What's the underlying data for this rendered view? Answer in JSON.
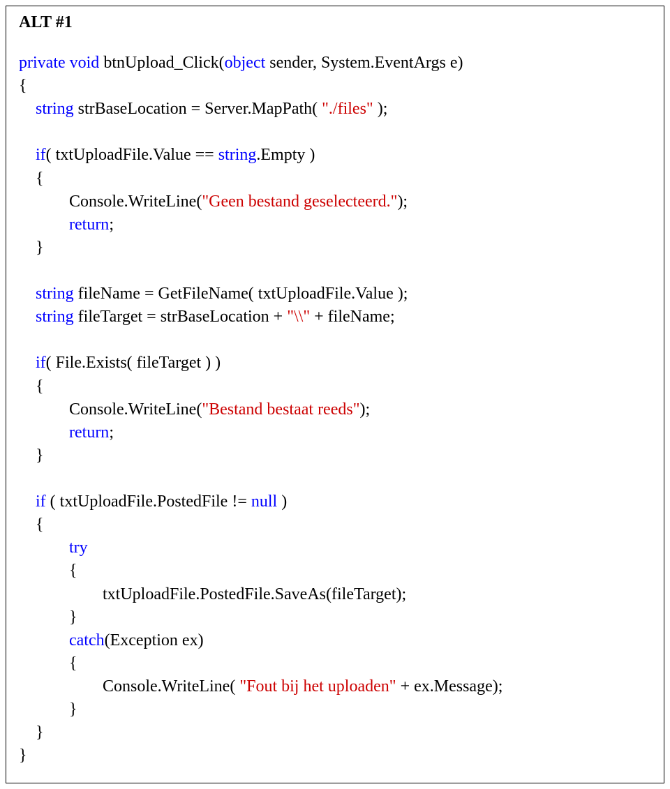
{
  "heading": "ALT #1",
  "code_segments": [
    {
      "t": "private void",
      "c": "kw"
    },
    {
      "t": " btnUpload_Click(",
      "c": ""
    },
    {
      "t": "object",
      "c": "kw"
    },
    {
      "t": " sender, System.EventArgs e)\n{\n    ",
      "c": ""
    },
    {
      "t": "string",
      "c": "kw"
    },
    {
      "t": " strBaseLocation = Server.MapPath( ",
      "c": ""
    },
    {
      "t": "\"./files\"",
      "c": "str"
    },
    {
      "t": " );\n\n    ",
      "c": ""
    },
    {
      "t": "if",
      "c": "kw"
    },
    {
      "t": "( txtUploadFile.Value == ",
      "c": ""
    },
    {
      "t": "string",
      "c": "kw"
    },
    {
      "t": ".Empty )\n    {\n            Console.WriteLine(",
      "c": ""
    },
    {
      "t": "\"Geen bestand geselecteerd.\"",
      "c": "str"
    },
    {
      "t": ");\n            ",
      "c": ""
    },
    {
      "t": "return",
      "c": "kw"
    },
    {
      "t": ";\n    }\n\n    ",
      "c": ""
    },
    {
      "t": "string",
      "c": "kw"
    },
    {
      "t": " fileName = GetFileName( txtUploadFile.Value );\n    ",
      "c": ""
    },
    {
      "t": "string",
      "c": "kw"
    },
    {
      "t": " fileTarget = strBaseLocation + ",
      "c": ""
    },
    {
      "t": "\"\\\\\"",
      "c": "str"
    },
    {
      "t": " + fileName;\n\n    ",
      "c": ""
    },
    {
      "t": "if",
      "c": "kw"
    },
    {
      "t": "( File.Exists( fileTarget ) )\n    {\n            Console.WriteLine(",
      "c": ""
    },
    {
      "t": "\"Bestand bestaat reeds\"",
      "c": "str"
    },
    {
      "t": ");\n            ",
      "c": ""
    },
    {
      "t": "return",
      "c": "kw"
    },
    {
      "t": ";\n    }\n\n    ",
      "c": ""
    },
    {
      "t": "if",
      "c": "kw"
    },
    {
      "t": " ( txtUploadFile.PostedFile != ",
      "c": ""
    },
    {
      "t": "null",
      "c": "kw"
    },
    {
      "t": " )\n    {\n            ",
      "c": ""
    },
    {
      "t": "try",
      "c": "kw"
    },
    {
      "t": "\n            {\n                    txtUploadFile.PostedFile.SaveAs(fileTarget);\n            }\n            ",
      "c": ""
    },
    {
      "t": "catch",
      "c": "kw"
    },
    {
      "t": "(Exception ex)\n            {\n                    Console.WriteLine( ",
      "c": ""
    },
    {
      "t": "\"Fout bij het uploaden\"",
      "c": "str"
    },
    {
      "t": " + ex.Message);\n            }\n    }\n}",
      "c": ""
    }
  ]
}
